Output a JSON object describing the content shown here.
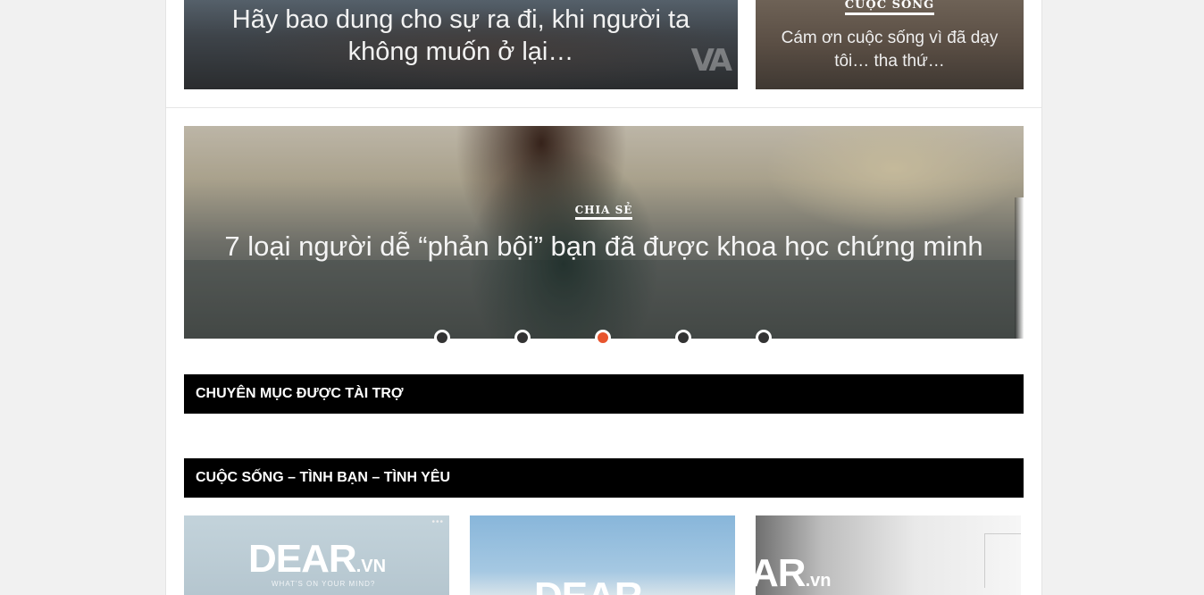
{
  "top_cards": {
    "left": {
      "title": "Hãy bao dung cho sự ra đi, khi người ta không muốn ở lại…",
      "logo_text": "VA"
    },
    "right": {
      "category": "CUỘC SỐNG",
      "title": "Cám ơn cuộc sống vì đã dạy tôi… tha thứ…"
    }
  },
  "slider": {
    "category": "CHIA SẺ",
    "title": "7 loại người dễ “phản bội” bạn đã được khoa học chứng minh",
    "dot_count": 5,
    "active_index": 2,
    "active_color": "#e8552e"
  },
  "sections": {
    "sponsored": "CHUYÊN MỤC ĐƯỢC TÀI TRỢ",
    "life": "CUỘC SỐNG – TÌNH BẠN – TÌNH YÊU"
  },
  "thumbnails": [
    {
      "logo": "DEAR",
      "logo_suffix": ".VN",
      "tagline": "WHAT'S ON YOUR MIND?"
    },
    {
      "logo": "DEAR",
      "logo_suffix": ""
    },
    {
      "logo": "AR",
      "logo_suffix": ".vn"
    }
  ]
}
